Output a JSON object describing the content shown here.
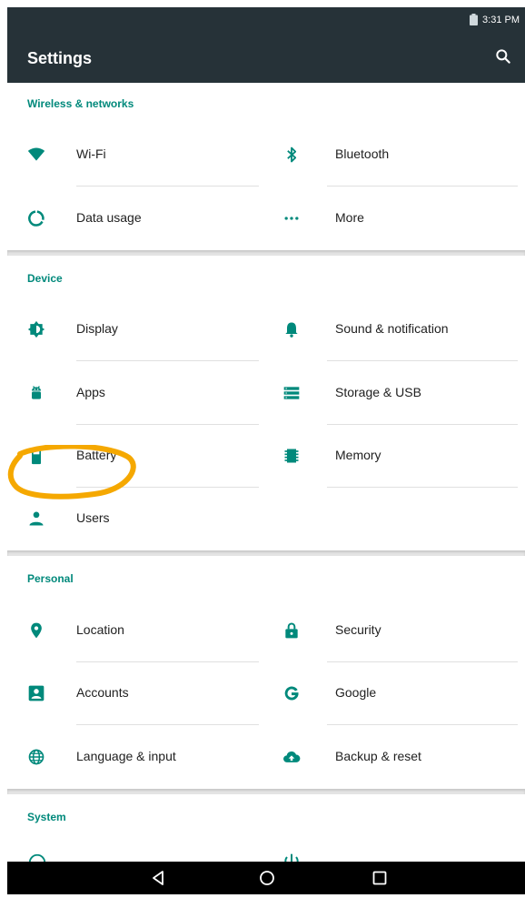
{
  "status_bar": {
    "time": "3:31 PM"
  },
  "app_bar": {
    "title": "Settings",
    "search_icon": "search-icon"
  },
  "accent_color": "#00897b",
  "bar_color": "#263238",
  "annotation_color": "#f5a800",
  "sections": {
    "wireless": {
      "title": "Wireless & networks",
      "wifi": "Wi-Fi",
      "bluetooth": "Bluetooth",
      "data_usage": "Data usage",
      "more": "More"
    },
    "device": {
      "title": "Device",
      "display": "Display",
      "sound": "Sound & notification",
      "apps": "Apps",
      "storage": "Storage & USB",
      "battery": "Battery",
      "memory": "Memory",
      "users": "Users"
    },
    "personal": {
      "title": "Personal",
      "location": "Location",
      "security": "Security",
      "accounts": "Accounts",
      "google": "Google",
      "language": "Language & input",
      "backup": "Backup & reset"
    },
    "system": {
      "title": "System"
    }
  },
  "nav": {
    "back": "back-icon",
    "home": "home-icon",
    "recents": "recents-icon"
  }
}
